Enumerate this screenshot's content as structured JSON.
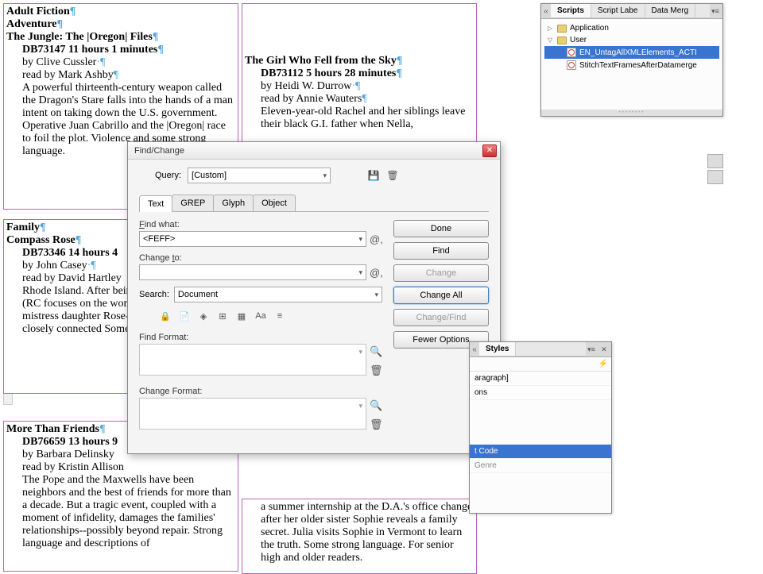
{
  "doc": {
    "h1": "Adult Fiction",
    "h2": "Adventure",
    "book1": {
      "title": "The Jungle: The |Oregon| Files",
      "meta": "DB73147 11 hours 1 minutes",
      "author": "by Clive Cussler",
      "reader": "read by Mark Ashby",
      "body": "A powerful thirteenth-century weapon called the Dragon's Stare falls into the hands of a man intent on taking down the U.S. government. Operative Juan Cabrillo and the |Oregon| race to foil the plot. Violence and some strong language."
    },
    "h3": "Family",
    "book2": {
      "title": "Compass Rose",
      "meta": "DB73346 14 hours 4",
      "author": "by John Casey",
      "reader": "read by David Hartley",
      "body": "Rhode Island. After being prequel |Spartina (RC focuses on the women May, his former mistress daughter Rose--and the their small, closely connected Some strong language."
    },
    "book3": {
      "title": "More Than Friends",
      "meta": "DB76659 13 hours 9",
      "author": "by Barbara Delinsky",
      "reader": "read by Kristin Allison",
      "body": "The Pope and the Maxwells have been neighbors and the best of friends for more than a decade. But a tragic event, coupled with a moment of infidelity, damages the families' relationships--possibly beyond repair. Strong language and descriptions of"
    },
    "book4": {
      "title": "The Girl Who Fell from the Sky",
      "meta": "DB73112 5 hours 28 minutes",
      "author": "by Heidi W. Durrow",
      "reader": "read by Annie Wauters",
      "body": "Eleven-year-old Rachel and her siblings leave their black G.I. father when Nella,"
    },
    "col2_cont": "a summer internship at the D.A.'s office change after her older sister Sophie reveals a family secret. Julia visits Sophie in Vermont to learn the truth. Some strong language. For senior high and older readers."
  },
  "dialog": {
    "title": "Find/Change",
    "query_label": "Query:",
    "query_value": "[Custom]",
    "tabs": {
      "text": "Text",
      "grep": "GREP",
      "glyph": "Glyph",
      "object": "Object"
    },
    "find_what_label": "Find what:",
    "find_what_value": "<FEFF>",
    "change_to_label": "Change to:",
    "change_to_value": "",
    "search_label": "Search:",
    "search_value": "Document",
    "find_format_label": "Find Format:",
    "change_format_label": "Change Format:",
    "buttons": {
      "done": "Done",
      "find": "Find",
      "change": "Change",
      "change_all": "Change All",
      "change_find": "Change/Find",
      "fewer": "Fewer Options"
    }
  },
  "scripts_panel": {
    "tabs": {
      "scripts": "Scripts",
      "label": "Script Labe",
      "merge": "Data Merg"
    },
    "app": "Application",
    "user": "User",
    "scripts": {
      "s1": "EN_UntagAllXMLElements_ACTI",
      "s2": "StitchTextFramesAfterDatamerge"
    }
  },
  "styles_panel": {
    "tab": "Styles",
    "rows": {
      "r1": "aragraph]",
      "r2": "ons",
      "r3": "t Code",
      "r4": "Genre"
    }
  }
}
